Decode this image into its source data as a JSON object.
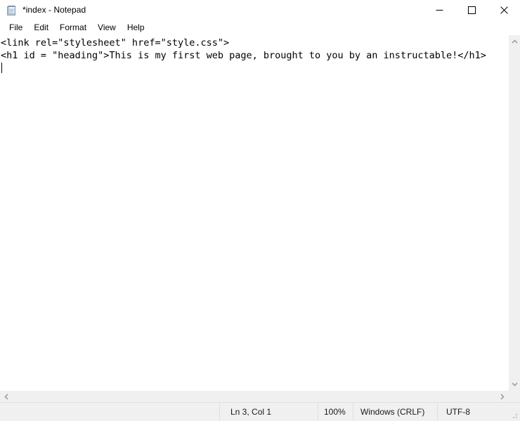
{
  "window": {
    "title": "*index - Notepad",
    "icon": "notepad-icon",
    "controls": {
      "minimize": "minimize-icon",
      "maximize": "maximize-icon",
      "close": "close-icon"
    }
  },
  "menubar": {
    "items": [
      {
        "label": "File"
      },
      {
        "label": "Edit"
      },
      {
        "label": "Format"
      },
      {
        "label": "View"
      },
      {
        "label": "Help"
      }
    ]
  },
  "editor": {
    "lines": [
      "<link rel=\"stylesheet\" href=\"style.css\">",
      "<h1 id = \"heading\">This is my first web page, brought to you by an instructable!</h1>",
      ""
    ],
    "text": "<link rel=\"stylesheet\" href=\"style.css\">\n<h1 id = \"heading\">This is my first web page, brought to you by an instructable!</h1>",
    "caret_line": 3,
    "caret_column": 1
  },
  "scrollbars": {
    "vertical": {
      "up": "chevron-up-icon",
      "down": "chevron-down-icon"
    },
    "horizontal": {
      "left": "chevron-left-icon",
      "right": "chevron-right-icon"
    }
  },
  "statusbar": {
    "position": "Ln 3, Col 1",
    "zoom": "100%",
    "line_ending": "Windows (CRLF)",
    "encoding": "UTF-8"
  },
  "colors": {
    "window_bg": "#ffffff",
    "statusbar_bg": "#f0f0f0",
    "scrollbar_bg": "#f0f0f0",
    "divider": "#dfdfdf",
    "text": "#000000",
    "arrow": "#a0a0a0"
  }
}
